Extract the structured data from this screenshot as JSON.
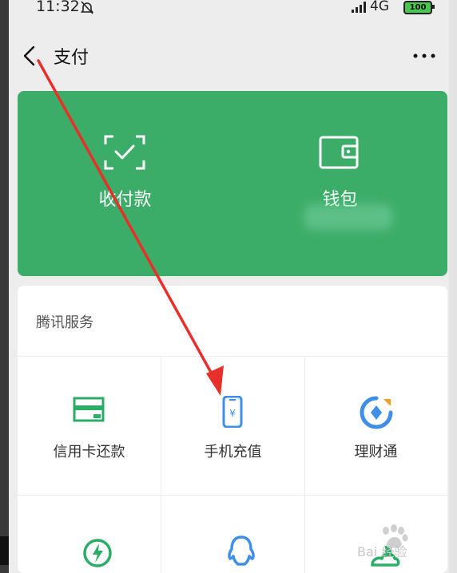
{
  "status_bar": {
    "time": "11:32",
    "network": "4G",
    "battery": "100",
    "icons": [
      "bell-muted-icon",
      "signal-icon",
      "battery-icon"
    ]
  },
  "nav": {
    "title": "支付",
    "icons": [
      "back-arrow-icon",
      "more-icon"
    ]
  },
  "card": {
    "color": "#3cad69",
    "actions": [
      {
        "label": "收付款",
        "icon": "scan-receive-icon"
      },
      {
        "label": "钱包",
        "icon": "wallet-icon"
      }
    ]
  },
  "services": {
    "title": "腾讯服务",
    "items": [
      {
        "label": "信用卡还款",
        "icon": "credit-card-icon",
        "color": "#2aae67"
      },
      {
        "label": "手机充值",
        "icon": "phone-recharge-icon",
        "color": "#3f8ee8"
      },
      {
        "label": "理财通",
        "icon": "wealth-icon",
        "color": "#3f8ee8"
      }
    ],
    "row2_icons": [
      "lightning-icon",
      "qq-icon",
      "city-icon"
    ]
  },
  "annotation": {
    "arrow_color": "#e8302a"
  },
  "watermark": {
    "text": "Bai 经验"
  }
}
